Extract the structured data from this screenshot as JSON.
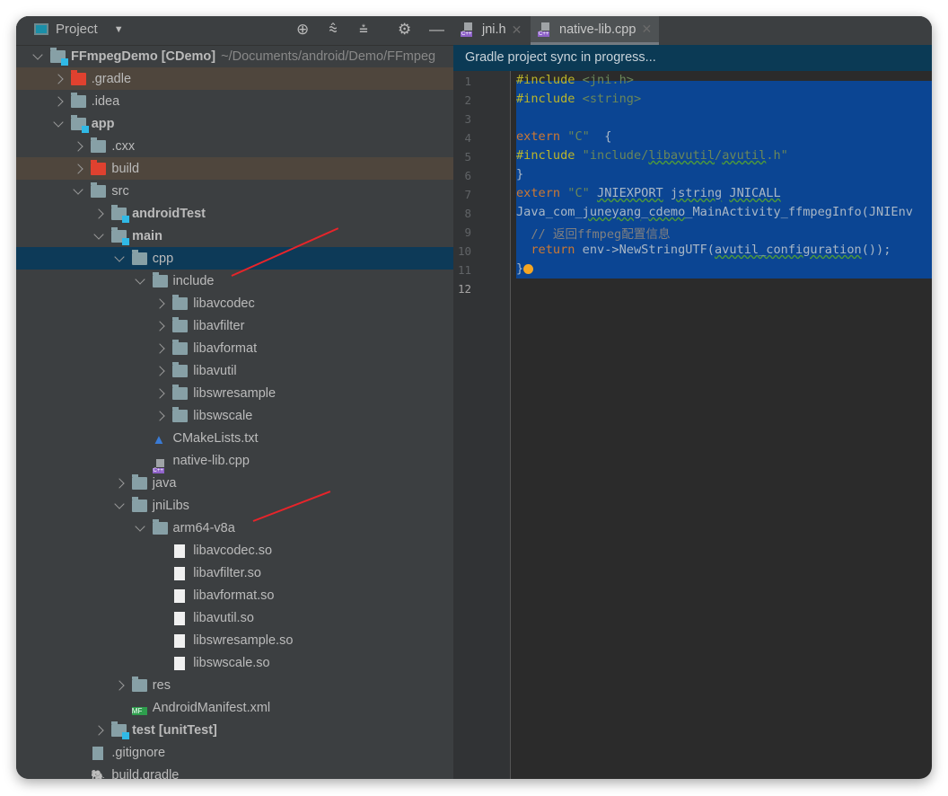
{
  "project_panel": {
    "title": "Project",
    "toolbar_icons": [
      "locate-icon",
      "expand-all-icon",
      "collapse-all-icon",
      "gear-icon",
      "minimize-icon"
    ],
    "tree": [
      {
        "level": 0,
        "chev": "e",
        "icon": "module",
        "label": "FFmpegDemo [CDemo]",
        "bold": true,
        "suffix": "~/Documents/android/Demo/FFmpeg"
      },
      {
        "level": 1,
        "chev": "c",
        "icon": "folder-red",
        "label": ".gradle",
        "hl": true
      },
      {
        "level": 1,
        "chev": "c",
        "icon": "folder",
        "label": ".idea"
      },
      {
        "level": 1,
        "chev": "e",
        "icon": "module",
        "label": "app",
        "bold": true
      },
      {
        "level": 2,
        "chev": "c",
        "icon": "folder",
        "label": ".cxx"
      },
      {
        "level": 2,
        "chev": "c",
        "icon": "folder-red",
        "label": "build",
        "hl": true
      },
      {
        "level": 2,
        "chev": "e",
        "icon": "folder",
        "label": "src"
      },
      {
        "level": 3,
        "chev": "c",
        "icon": "module",
        "label": "androidTest",
        "bold": true
      },
      {
        "level": 3,
        "chev": "e",
        "icon": "module",
        "label": "main",
        "bold": true
      },
      {
        "level": 4,
        "chev": "e",
        "icon": "folder",
        "label": "cpp",
        "sel": true
      },
      {
        "level": 5,
        "chev": "e",
        "icon": "folder",
        "label": "include"
      },
      {
        "level": 6,
        "chev": "c",
        "icon": "folder",
        "label": "libavcodec"
      },
      {
        "level": 6,
        "chev": "c",
        "icon": "folder",
        "label": "libavfilter"
      },
      {
        "level": 6,
        "chev": "c",
        "icon": "folder",
        "label": "libavformat"
      },
      {
        "level": 6,
        "chev": "c",
        "icon": "folder",
        "label": "libavutil"
      },
      {
        "level": 6,
        "chev": "c",
        "icon": "folder",
        "label": "libswresample"
      },
      {
        "level": 6,
        "chev": "c",
        "icon": "folder",
        "label": "libswscale"
      },
      {
        "level": 5,
        "chev": "",
        "icon": "cmake",
        "label": "CMakeLists.txt"
      },
      {
        "level": 5,
        "chev": "",
        "icon": "cpp",
        "label": "native-lib.cpp"
      },
      {
        "level": 4,
        "chev": "c",
        "icon": "folder",
        "label": "java"
      },
      {
        "level": 4,
        "chev": "e",
        "icon": "folder",
        "label": "jniLibs"
      },
      {
        "level": 5,
        "chev": "e",
        "icon": "folder",
        "label": "arm64-v8a"
      },
      {
        "level": 6,
        "chev": "",
        "icon": "file",
        "label": "libavcodec.so"
      },
      {
        "level": 6,
        "chev": "",
        "icon": "file",
        "label": "libavfilter.so"
      },
      {
        "level": 6,
        "chev": "",
        "icon": "file",
        "label": "libavformat.so"
      },
      {
        "level": 6,
        "chev": "",
        "icon": "file",
        "label": "libavutil.so"
      },
      {
        "level": 6,
        "chev": "",
        "icon": "file",
        "label": "libswresample.so"
      },
      {
        "level": 6,
        "chev": "",
        "icon": "file",
        "label": "libswscale.so"
      },
      {
        "level": 4,
        "chev": "c",
        "icon": "folder-res",
        "label": "res"
      },
      {
        "level": 4,
        "chev": "",
        "icon": "manifest",
        "label": "AndroidManifest.xml"
      },
      {
        "level": 3,
        "chev": "c",
        "icon": "module",
        "label": "test [unitTest]",
        "bold": true
      },
      {
        "level": 2,
        "chev": "",
        "icon": "gitignore",
        "label": ".gitignore"
      },
      {
        "level": 2,
        "chev": "",
        "icon": "gradle",
        "label": "build.gradle"
      }
    ]
  },
  "editor": {
    "tabs": [
      {
        "label": "jni.h",
        "active": false
      },
      {
        "label": "native-lib.cpp",
        "active": true
      }
    ],
    "banner": "Gradle project sync in progress...",
    "line_numbers": [
      "1",
      "2",
      "3",
      "4",
      "5",
      "6",
      "7",
      "8",
      "9",
      "10",
      "11",
      "12"
    ],
    "lines": [
      [
        [
          "pp",
          "#include "
        ],
        [
          "str",
          "<jni.h>"
        ]
      ],
      [
        [
          "pp",
          "#include "
        ],
        [
          "str",
          "<string>"
        ]
      ],
      [],
      [
        [
          "kw",
          "extern "
        ],
        [
          "str",
          "\"C\""
        ],
        [
          "",
          "  {"
        ]
      ],
      [
        [
          "pp",
          "#include "
        ],
        [
          "str",
          "\"include/"
        ],
        [
          "str wv",
          "libavutil"
        ],
        [
          "str",
          "/"
        ],
        [
          "str wv",
          "avutil"
        ],
        [
          "str",
          ".h\""
        ]
      ],
      [
        [
          "",
          "}"
        ]
      ],
      [
        [
          "kw",
          "extern "
        ],
        [
          "str",
          "\"C\" "
        ],
        [
          "wv",
          "JNIEXPORT"
        ],
        [
          "",
          " "
        ],
        [
          "wv",
          "jstring"
        ],
        [
          "",
          " "
        ],
        [
          "wv",
          "JNICALL"
        ]
      ],
      [
        [
          "",
          "Java_com_"
        ],
        [
          "wv",
          "juneyang"
        ],
        [
          "",
          "_"
        ],
        [
          "wv",
          "cdemo"
        ],
        [
          "",
          "_MainActivity_ffmpegInfo(JNIEnv"
        ]
      ],
      [
        [
          "cm",
          "  // 返回ffmpeg配置信息"
        ]
      ],
      [
        [
          "kw",
          "  return "
        ],
        [
          "",
          "env->NewStringUTF("
        ],
        [
          "wv",
          "avutil_configuration"
        ],
        [
          "",
          "());"
        ]
      ],
      [
        [
          "",
          "}"
        ]
      ],
      []
    ],
    "selection_color": "#0b4593"
  }
}
